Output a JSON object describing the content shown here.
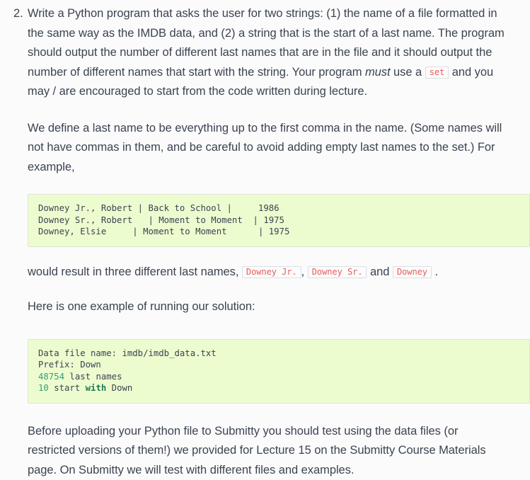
{
  "list": {
    "marker": "2.",
    "paragraphs": {
      "p1_part1": "Write a Python program that asks the user for two strings: (1) the name of a file formatted in the same way as the IMDB data, and (2) a string that is the start of a last name. The program should output the number of different last names that are in the file and it should output the number of different names that start with the string. Your program ",
      "p1_em": "must",
      "p1_part2": " use a ",
      "p1_code": "set",
      "p1_part3": " and you may / are encouraged to start from the code written during lecture.",
      "p2": "We define a last name to be everything up to the first comma in the name. (Some names will not have commas in them, and be careful to avoid adding empty last names to the set.) For example,",
      "p3_part1": "would result in three different last names, ",
      "p3_code1": "Downey Jr.",
      "p3_part2": ", ",
      "p3_code2": "Downey Sr.",
      "p3_part3": " and ",
      "p3_code3": "Downey",
      "p3_part4": " .",
      "p4": "Here is one example of running our solution:",
      "p5": "Before uploading your Python file to Submitty you should test using the data files (or restricted versions of them!) we provided for Lecture 15 on the Submitty Course Materials page. On Submitty we will test with different files and examples."
    }
  },
  "code_block_imdb": {
    "line1": "Downey Jr., Robert | Back to School |     1986",
    "line2": "Downey Sr., Robert   | Moment to Moment  | 1975",
    "line3": "Downey, Elsie     | Moment to Moment      | 1975"
  },
  "code_block_output": {
    "line1": "Data file name: imdb/imdb_data.txt",
    "line2": "Prefix: Down",
    "line3_num": "48754",
    "line3_rest": " last names",
    "line4_num": "10",
    "line4_mid": " start ",
    "line4_kw": "with",
    "line4_rest": " Down"
  },
  "colors": {
    "page_background": "#fbfbfb",
    "body_text": "#3b4351",
    "code_block_background": "#edfccf",
    "code_block_border": "#dfe4d6",
    "inline_code_text": "#e85c5c",
    "inline_code_border": "#dadee4",
    "syntax_number": "#2f9e7e",
    "syntax_keyword": "#1b7a51"
  }
}
